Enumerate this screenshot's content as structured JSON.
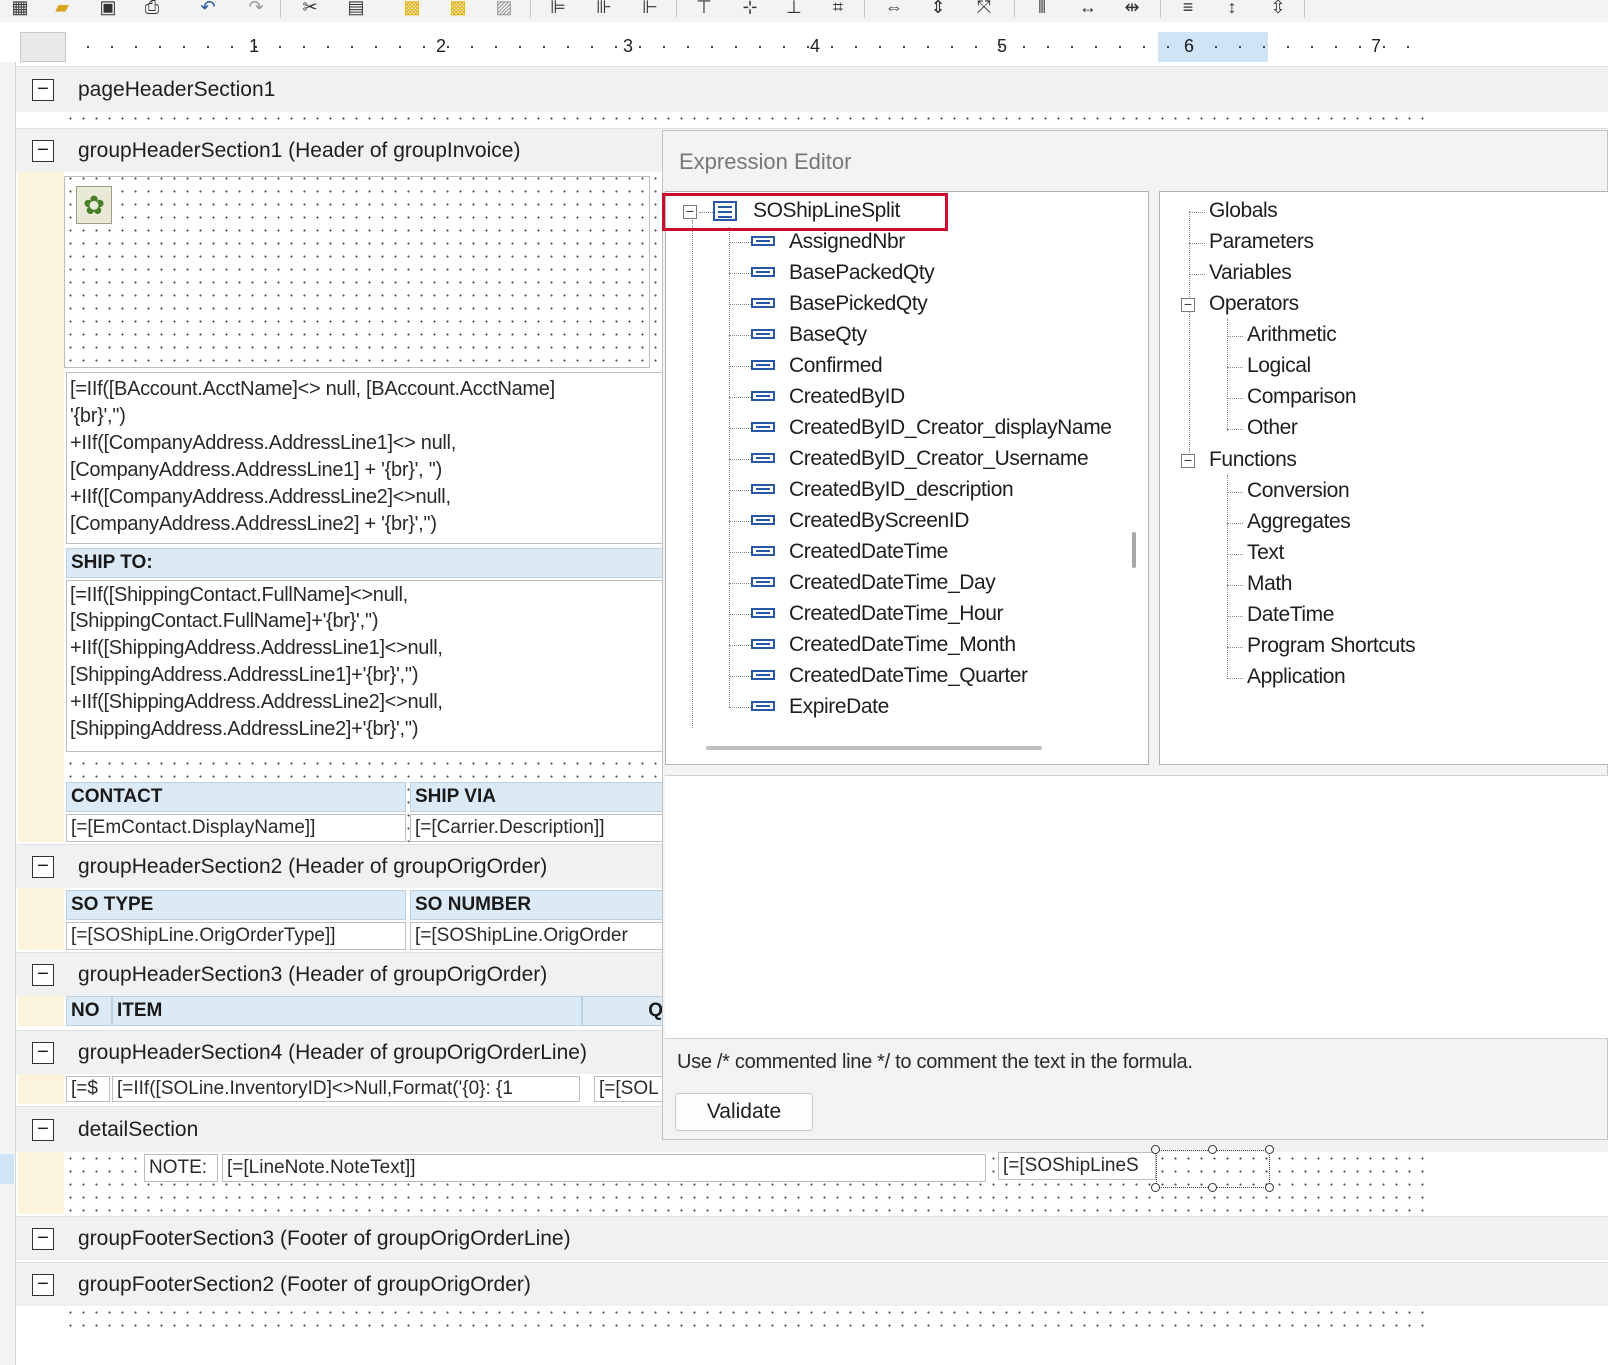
{
  "toolbar": {
    "icons": [
      "report-icon",
      "open-icon",
      "save-icon",
      "print-icon",
      "undo-icon",
      "redo-icon",
      "cut-icon",
      "paste-icon",
      "copy-icon",
      "copy-format-icon",
      "bring-front-icon",
      "align-left-icon",
      "align-center-icon",
      "align-right-icon",
      "align-top-icon",
      "align-middle-icon",
      "align-bottom-icon",
      "align-grid-icon",
      "same-width-icon",
      "same-height-icon",
      "same-size-icon",
      "h-spacing-equal-icon",
      "h-spacing-increase-icon",
      "h-spacing-decrease-icon",
      "v-spacing-equal-icon",
      "v-spacing-increase-icon",
      "v-spacing-decrease-icon"
    ]
  },
  "ruler": {
    "numbers": [
      "1",
      "2",
      "3",
      "4",
      "5",
      "6",
      "7"
    ]
  },
  "sections": {
    "page_header": "pageHeaderSection1",
    "group_header_1": "groupHeaderSection1 (Header of groupInvoice)",
    "group_header_2": "groupHeaderSection2 (Header of groupOrigOrder)",
    "group_header_3": "groupHeaderSection3 (Header of groupOrigOrder)",
    "group_header_4": "groupHeaderSection4 (Header of groupOrigOrderLine)",
    "detail": "detailSection",
    "group_footer_3": "groupFooterSection3 (Footer of groupOrigOrderLine)",
    "group_footer_2": "groupFooterSection2 (Footer of groupOrigOrder)"
  },
  "report": {
    "company_address_lines": [
      "[=IIf([BAccount.AcctName]<> null, [BAccount.AcctName]",
      "'{br}','')",
      "+IIf([CompanyAddress.AddressLine1]<> null,",
      "[CompanyAddress.AddressLine1] + '{br}', '')",
      "+IIf([CompanyAddress.AddressLine2]<>null,",
      "[CompanyAddress.AddressLine2] + '{br}','')"
    ],
    "ship_to_label": "SHIP TO:",
    "ship_to_lines": [
      "[=IIf([ShippingContact.FullName]<>null,",
      "[ShippingContact.FullName]+'{br}','')",
      "+IIf([ShippingAddress.AddressLine1]<>null,",
      "[ShippingAddress.AddressLine1]+'{br}','')",
      "+IIf([ShippingAddress.AddressLine2]<>null,",
      "[ShippingAddress.AddressLine2]+'{br}','')"
    ],
    "contact_header": "CONTACT",
    "ship_via_header": "SHIP VIA",
    "contact_value": "[=[EmContact.DisplayName]]",
    "ship_via_value": "[=[Carrier.Description]]",
    "so_type_header": "SO TYPE",
    "so_number_header": "SO NUMBER",
    "so_type_value": "[=[SOShipLine.OrigOrderType]]",
    "so_number_value": "[=[SOShipLine.OrigOrder",
    "no_header": "NO",
    "item_header": "ITEM",
    "q_header": "Q",
    "line_no_value": "[=$",
    "line_item_value": "[=IIf([SOLine.InventoryID]<>Null,Format('{0}: {1",
    "line_sol_value": "[=[SOL",
    "note_label": "NOTE:",
    "note_value": "[=[LineNote.NoteText]]",
    "detail_shipline_value": "[=[SOShipLineS"
  },
  "dialog": {
    "title": "Expression Editor",
    "fields_root": "SOShipLineSplit",
    "fields": [
      "AssignedNbr",
      "BasePackedQty",
      "BasePickedQty",
      "BaseQty",
      "Confirmed",
      "CreatedByID",
      "CreatedByID_Creator_displayName",
      "CreatedByID_Creator_Username",
      "CreatedByID_description",
      "CreatedByScreenID",
      "CreatedDateTime",
      "CreatedDateTime_Day",
      "CreatedDateTime_Hour",
      "CreatedDateTime_Month",
      "CreatedDateTime_Quarter",
      "ExpireDate"
    ],
    "categories": {
      "globals": "Globals",
      "parameters": "Parameters",
      "variables": "Variables",
      "operators": "Operators",
      "operators_children": [
        "Arithmetic",
        "Logical",
        "Comparison",
        "Other"
      ],
      "functions": "Functions",
      "functions_children": [
        "Conversion",
        "Aggregates",
        "Text",
        "Math",
        "DateTime",
        "Program Shortcuts",
        "Application"
      ]
    },
    "hint": "Use /* commented line */ to comment the text in the formula.",
    "validate_label": "Validate",
    "highlight_color": "#c8102e"
  },
  "colors": {
    "header_cell": "#dceaf6",
    "band": "#f1f1f1",
    "strip": "#fbf3dc",
    "field_icon": "#2857a4"
  }
}
